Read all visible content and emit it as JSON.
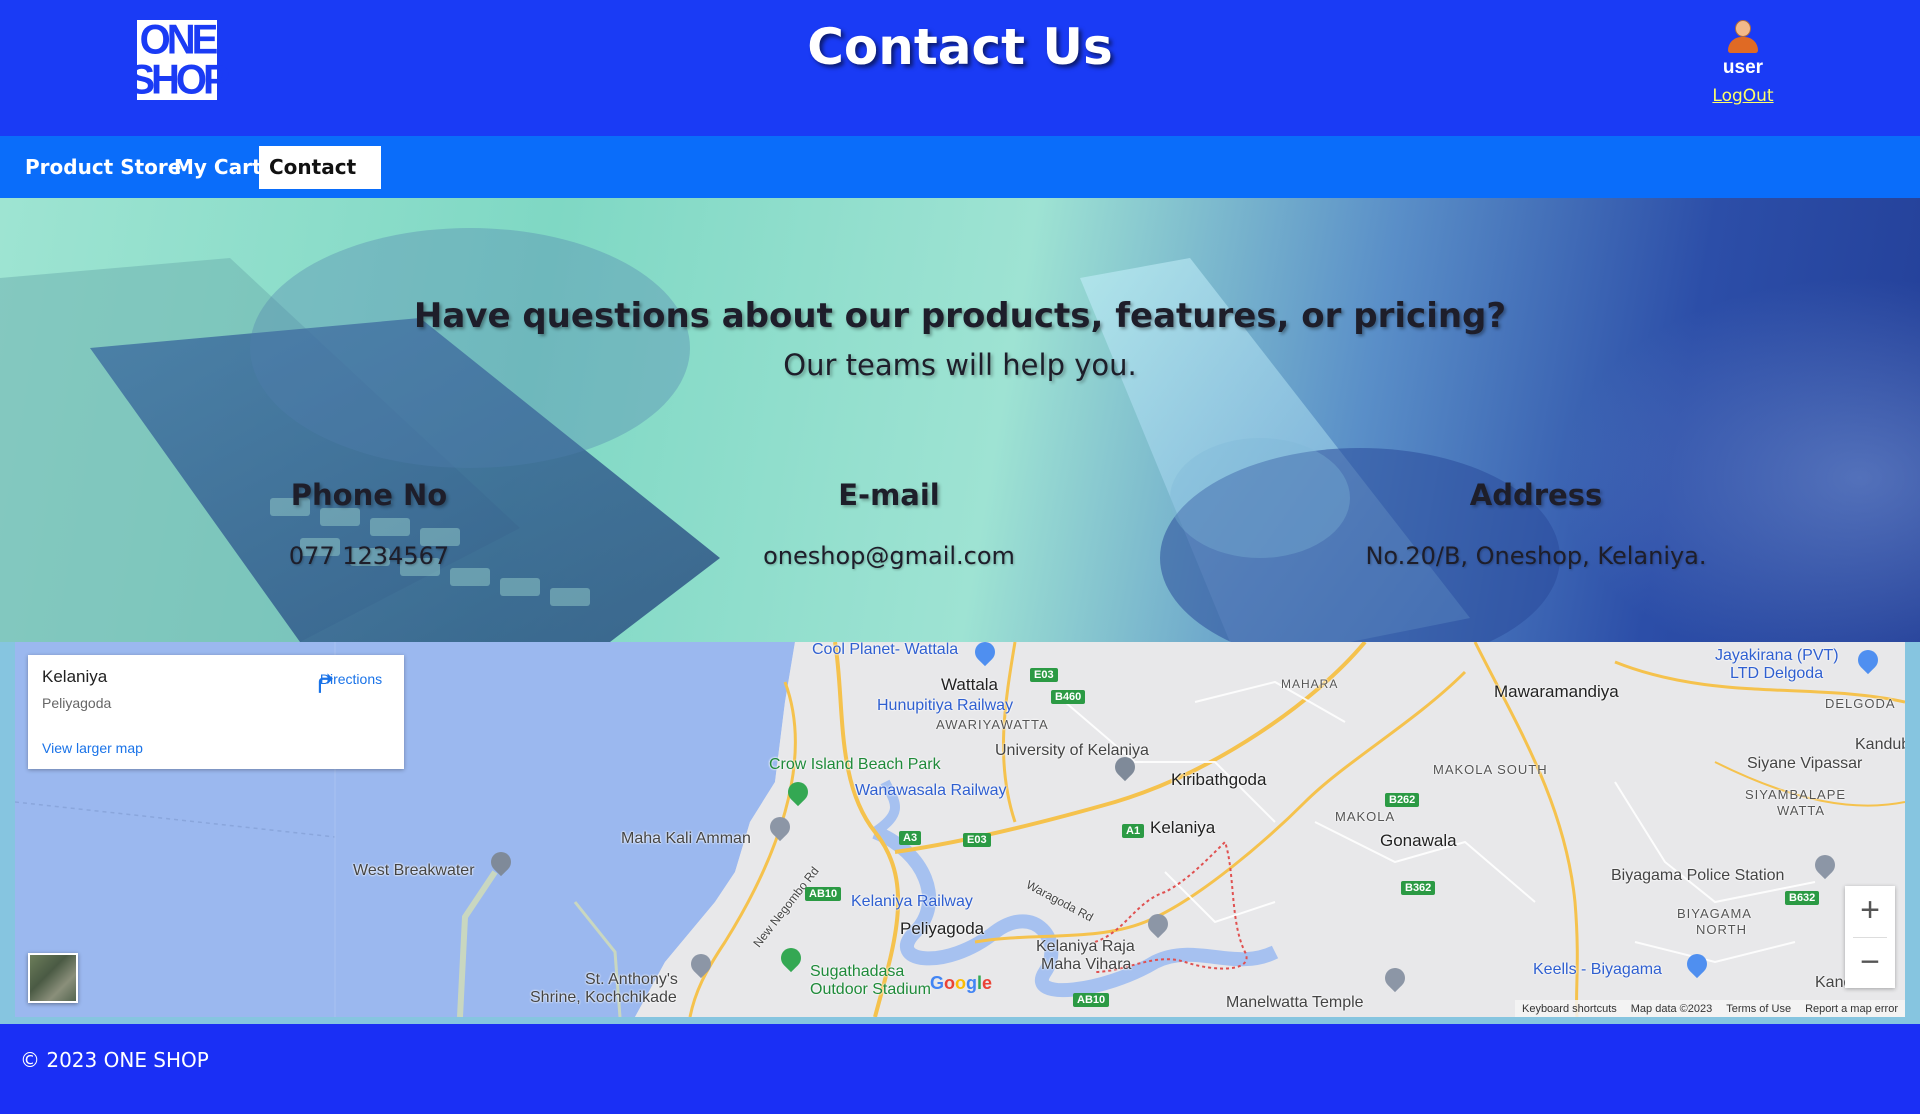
{
  "header": {
    "logo_line1": "ONE",
    "logo_line2": "SHOP",
    "title": "Contact Us",
    "user_name": "user",
    "logout_label": "LogOut"
  },
  "nav": {
    "items": [
      {
        "label": "Product Store",
        "active": false
      },
      {
        "label": "My Cart",
        "active": false
      },
      {
        "label": "Contact Us",
        "active": true
      }
    ]
  },
  "hero": {
    "heading": "Have questions about our products, features, or pricing?",
    "subheading": "Our teams will help you.",
    "contacts": [
      {
        "label": "Phone No",
        "value": "077 1234567"
      },
      {
        "label": "E-mail",
        "value": "oneshop@gmail.com"
      },
      {
        "label": "Address",
        "value": "No.20/B, Oneshop, Kelaniya."
      }
    ]
  },
  "map": {
    "place_name": "Kelaniya",
    "place_area": "Peliyagoda",
    "directions_label": "Directions",
    "larger_map_label": "View larger map",
    "zoom_in": "+",
    "zoom_out": "−",
    "google": "Google",
    "attribution": [
      "Keyboard shortcuts",
      "Map data ©2023",
      "Terms of Use",
      "Report a map error"
    ],
    "labels": {
      "cool_planet": "Cool Planet- Wattala",
      "wattala": "Wattala",
      "hunupitiya": "Hunupitiya Railway",
      "awariyawatta": "AWARIYAWATTA",
      "univ": "University of Kelaniya",
      "kiribathgoda": "Kiribathgoda",
      "crow_island": "Crow Island Beach Park",
      "wanawasala": "Wanawasala Railway",
      "maha_kali": "Maha Kali Amman",
      "kelaniya": "Kelaniya",
      "west_breakwater": "West Breakwater",
      "kelaniya_railway": "Kelaniya Railway",
      "peliyagoda": "Peliyagoda",
      "new_negombo": "New Negombo Rd",
      "waragoda": "Waragoda Rd",
      "raja_maha_1": "Kelaniya Raja",
      "raja_maha_2": "Maha Vihara",
      "sugathadasa_1": "Sugathadasa",
      "sugathadasa_2": "Outdoor Stadium",
      "st_anthony_1": "St. Anthony's",
      "st_anthony_2": "Shrine, Kochchikade",
      "manelwatta": "Manelwatta Temple",
      "mahara": "MAHARA",
      "mawaramandiya": "Mawaramandiya",
      "makola_south": "MAKOLA SOUTH",
      "makola": "MAKOLA",
      "gonawala": "Gonawala",
      "jayakirana_1": "Jayakirana (PVT)",
      "jayakirana_2": "LTD Delgoda",
      "delgoda": "DELGODA",
      "kandubo": "Kandubo",
      "siyane": "Siyane Vipassar",
      "siyambalape_1": "SIYAMBALAPE",
      "siyambalape_2": "WATTA",
      "biyagama_police": "Biyagama Police Station",
      "biyagama_north_1": "BIYAGAMA",
      "biyagama_north_2": "NORTH",
      "keells": "Keells - Biyagama",
      "kandawala": "Kandawala"
    },
    "road_badges": {
      "e03a": "E03",
      "b460": "B460",
      "a3": "A3",
      "e03b": "E03",
      "a1": "A1",
      "ab10a": "AB10",
      "ab10b": "AB10",
      "b262": "B262",
      "b362": "B362",
      "b632": "B632"
    }
  },
  "footer": {
    "copyright": "© 2023 ONE SHOP"
  },
  "colors": {
    "header_bg": "#1a3bf5",
    "nav_bg": "#0a6dfa",
    "footer_bg": "#1a2ff5",
    "logout_link": "#ffff66"
  }
}
